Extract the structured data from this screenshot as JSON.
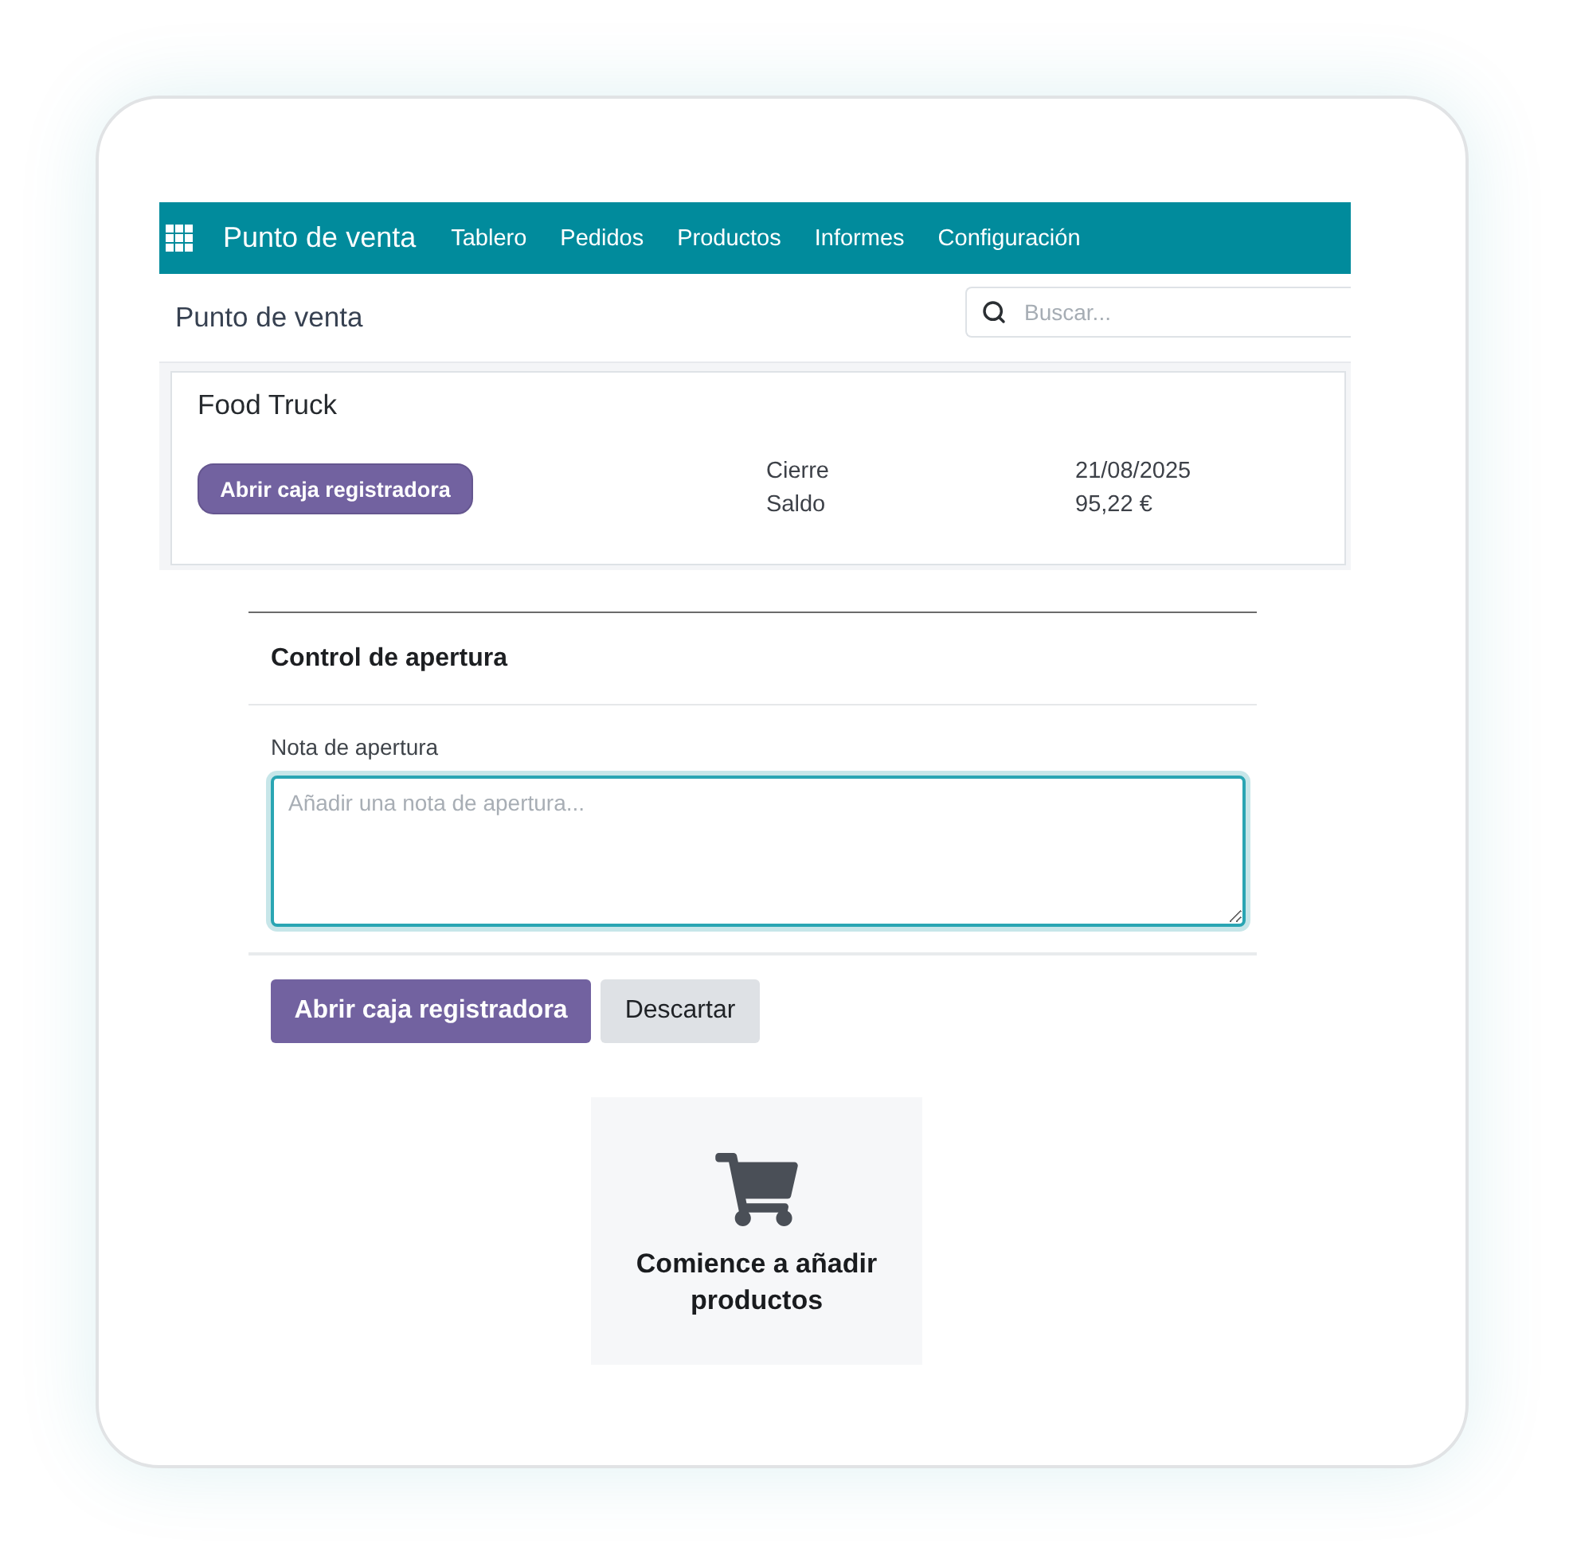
{
  "navbar": {
    "app_name": "Punto de venta",
    "menu": [
      "Tablero",
      "Pedidos",
      "Productos",
      "Informes",
      "Configuración"
    ]
  },
  "control_panel": {
    "title": "Punto de venta",
    "search": {
      "placeholder": "Buscar..."
    }
  },
  "pos_card": {
    "name": "Food Truck",
    "button": "Abrir caja registradora",
    "details": [
      {
        "label": "Cierre",
        "value": "21/08/2025"
      },
      {
        "label": "Saldo",
        "value": "95,22 €"
      }
    ]
  },
  "dialog": {
    "title": "Control de apertura",
    "note": {
      "label": "Nota de apertura",
      "placeholder": "Añadir una nota de apertura..."
    },
    "buttons": [
      {
        "label": "Abrir caja registradora",
        "kind": "primary"
      },
      {
        "label": "Descartar",
        "kind": "secondary"
      }
    ]
  },
  "empty_state": {
    "message": "Comience a añadir productos"
  }
}
